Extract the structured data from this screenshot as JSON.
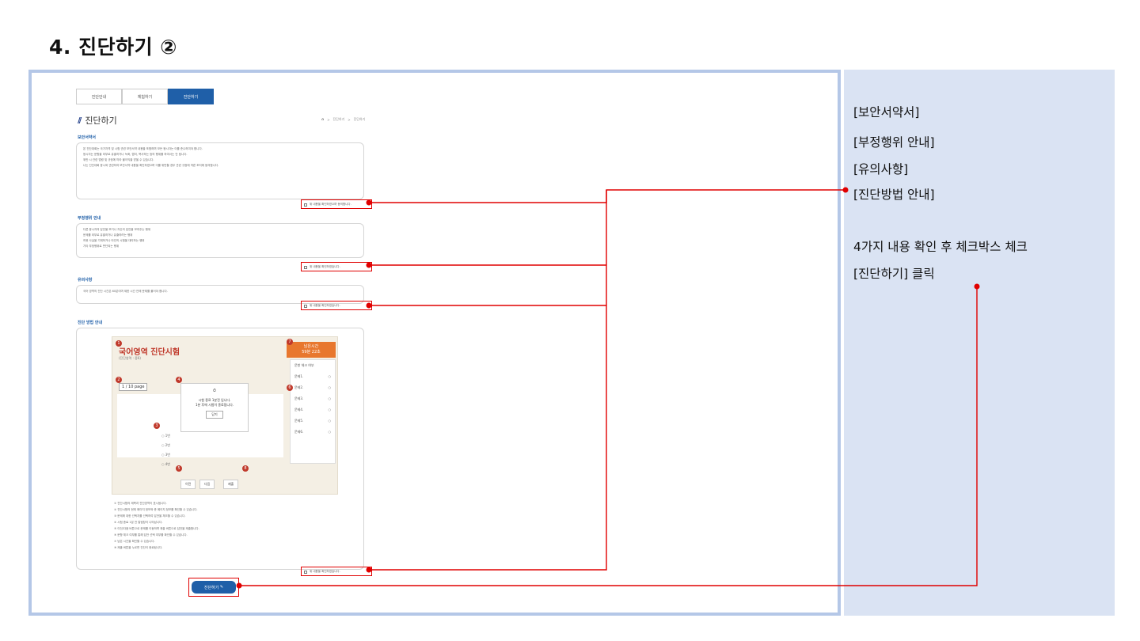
{
  "slide": {
    "title": "4. 진단하기 ②"
  },
  "notes": {
    "items": [
      "[보안서약서]",
      "[부정행위 안내]",
      "[유의사항]",
      "[진단방법 안내]"
    ],
    "instruction_1": "4가지 내용 확인 후 체크박스 체크",
    "instruction_2": "[진단하기] 클릭"
  },
  "web": {
    "tabs": [
      "진단안내",
      "체험하기",
      "진단하기"
    ],
    "page_title": "진단하기",
    "breadcrumb": [
      "진단하기",
      "진단하기"
    ],
    "sections": {
      "security_title": "보안서약서",
      "security_lines": [
        "본 진단대회는 국가자격 및 시험 관련 보안서약 내용을 포함하며 모든 응시자는 이를 준수하여야 합니다.",
        "응시자는 문항을 외부로 유출하거나 녹화, 캡처, 복사하는 등의 행위를 하여서는 안 됩니다.",
        "위반 시 관련 법령 및 규정에 따라 불이익을 받을 수 있습니다.",
        "",
        "나는 진단대회 응시와 관련하여 보안서약 내용을 확인하였으며 이를 위반할 경우 관련 규정에 따른 조치에 동의합니다."
      ],
      "security_agree": "위 내용을 확인하였으며 동의합니다.",
      "cheat_title": "부정행위 안내",
      "cheat_lines": [
        "다른 응시자의 답안을 보거나 자신의 답안을 보여주는 행위",
        "문제를 외부로 유출하거나 유출하려는 행위",
        "허위 사실을 기재하거나 타인의 시험을 대리하는 행위",
        "기타 부정행위로 판단되는 행위"
      ],
      "cheat_agree": "위 내용을 확인하였습니다.",
      "caution_title": "유의사항",
      "caution_lines": [
        "국어 영역의 진단 시간은 60분이며 제한 시간 안에 문제를 풀어야 합니다."
      ],
      "caution_agree": "위 내용을 확인하였습니다.",
      "method_title": "진단 방법 안내",
      "method_agree": "위 내용을 확인하였습니다."
    },
    "mock": {
      "exam_title": "국어영역 진단시험",
      "exam_sub": "(진단영역 : 중6)",
      "timer_label": "남은시간",
      "timer_value": "59분 22초",
      "page_indicator": "1 / 10 page",
      "side_header": "문항 체크 여부",
      "side_rows": [
        "문제1.",
        "문제2.",
        "문제3.",
        "문제4.",
        "문제5.",
        "문제6."
      ],
      "modal_title": "시험 종료 1분전 입니다.",
      "modal_body": "1분 후에 시험이 종료됩니다.",
      "modal_ok": "닫기",
      "options": [
        "1번",
        "2번",
        "3번",
        "4번"
      ],
      "nav": [
        "이전",
        "다음",
        "제출"
      ],
      "callouts": [
        "1",
        "2",
        "3",
        "4",
        "5",
        "6",
        "7",
        "8"
      ]
    },
    "instructions": [
      "① 진단시험의 제목과 진단영역이 표시됩니다.",
      "② 진단시험의 현재 페이지 정보와 총 페이지 정보를 확인할 수 있습니다.",
      "③ 문제에 대한 선택지를 선택하여 답안을 체크할 수 있습니다.",
      "④ 시험 종료 1분 전 알림창이 나타납니다.",
      "⑤ 이전/다음 버튼으로 문제를 이동하며 제출 버튼으로 답안을 제출합니다.",
      "⑥ 문항 체크 여부를 통해 답안 선택 여부를 확인할 수 있습니다.",
      "⑦ 남은 시간을 확인할 수 있습니다.",
      "⑧ 제출 버튼을 누르면 진단이 종료됩니다."
    ],
    "start_button": "진단하기"
  }
}
